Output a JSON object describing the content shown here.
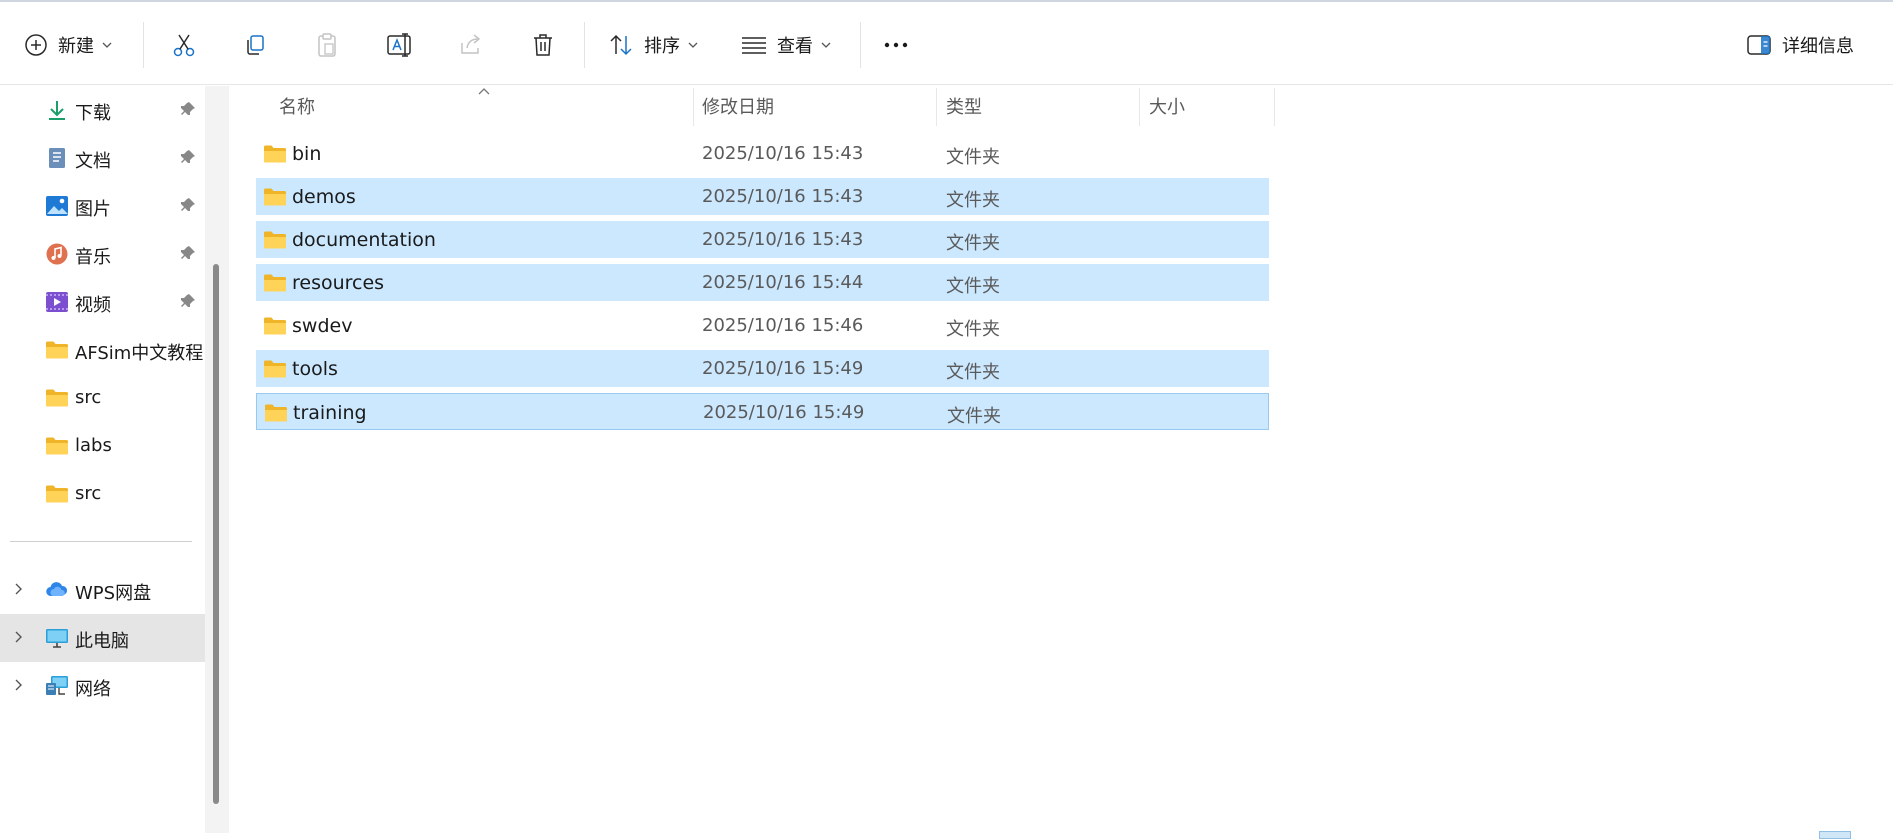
{
  "toolbar": {
    "new_label": "新建",
    "sort_label": "排序",
    "view_label": "查看",
    "more_label": "···",
    "details_label": "详细信息"
  },
  "nav": {
    "quick_access": [
      {
        "label": "下载",
        "icon": "download-icon",
        "pinned": true
      },
      {
        "label": "文档",
        "icon": "documents-icon",
        "pinned": true
      },
      {
        "label": "图片",
        "icon": "pictures-icon",
        "pinned": true
      },
      {
        "label": "音乐",
        "icon": "music-icon",
        "pinned": true
      },
      {
        "label": "视频",
        "icon": "videos-icon",
        "pinned": true
      },
      {
        "label": "AFSim中文教程",
        "icon": "folder-icon",
        "pinned": false
      },
      {
        "label": "src",
        "icon": "folder-icon",
        "pinned": false
      },
      {
        "label": "labs",
        "icon": "folder-icon",
        "pinned": false
      },
      {
        "label": "src",
        "icon": "folder-icon",
        "pinned": false
      }
    ],
    "locations": [
      {
        "label": "WPS网盘",
        "icon": "cloud-icon",
        "active": false
      },
      {
        "label": "此电脑",
        "icon": "this-pc-icon",
        "active": true
      },
      {
        "label": "网络",
        "icon": "network-icon",
        "active": false
      }
    ]
  },
  "columns": {
    "name": "名称",
    "date": "修改日期",
    "type": "类型",
    "size": "大小"
  },
  "files": [
    {
      "name": "bin",
      "date": "2025/10/16 15:43",
      "type": "文件夹",
      "selected": false
    },
    {
      "name": "demos",
      "date": "2025/10/16 15:43",
      "type": "文件夹",
      "selected": true
    },
    {
      "name": "documentation",
      "date": "2025/10/16 15:43",
      "type": "文件夹",
      "selected": true
    },
    {
      "name": "resources",
      "date": "2025/10/16 15:44",
      "type": "文件夹",
      "selected": true
    },
    {
      "name": "swdev",
      "date": "2025/10/16 15:46",
      "type": "文件夹",
      "selected": false
    },
    {
      "name": "tools",
      "date": "2025/10/16 15:49",
      "type": "文件夹",
      "selected": true
    },
    {
      "name": "training",
      "date": "2025/10/16 15:49",
      "type": "文件夹",
      "selected": true
    }
  ],
  "colors": {
    "selection": "#cce8ff",
    "selection_border": "#99c9f0",
    "folder": "#f8c73e",
    "accent": "#1a73c8"
  }
}
